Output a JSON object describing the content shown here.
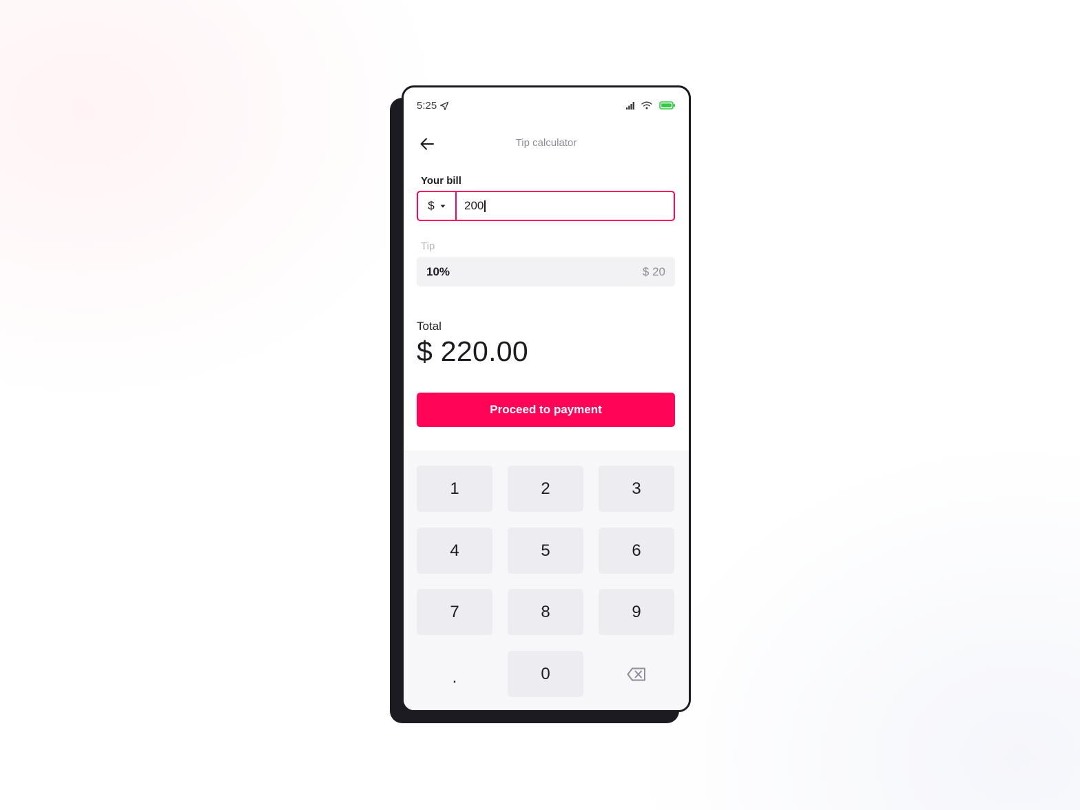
{
  "status_bar": {
    "time": "5:25",
    "location_icon": "location-arrow-icon",
    "signal_icon": "cellular-signal-icon",
    "wifi_icon": "wifi-icon",
    "battery_icon": "battery-icon",
    "battery_color": "#2ecc40"
  },
  "nav": {
    "back_icon": "arrow-left-icon",
    "title": "Tip calculator"
  },
  "bill": {
    "label": "Your bill",
    "currency": "$",
    "currency_dropdown_icon": "caret-down-icon",
    "value": "200"
  },
  "tip": {
    "label": "Tip",
    "percent": "10%",
    "amount": "$ 20"
  },
  "total": {
    "label": "Total",
    "value": "$ 220.00"
  },
  "proceed_button": {
    "label": "Proceed to payment"
  },
  "keypad": {
    "keys": [
      "1",
      "2",
      "3",
      "4",
      "5",
      "6",
      "7",
      "8",
      "9",
      ".",
      "0"
    ],
    "backspace_icon": "backspace-icon"
  },
  "colors": {
    "accent": "#ff0457",
    "text_primary": "#1c1b21",
    "text_muted": "#8e8d98",
    "field_bg": "#f2f2f5",
    "key_bg": "#ededf1"
  }
}
